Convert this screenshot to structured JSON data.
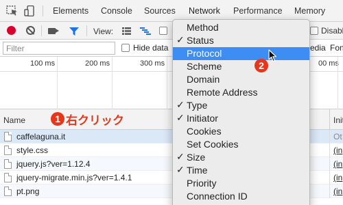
{
  "tabs": {
    "elements": "Elements",
    "console": "Console",
    "sources": "Sources",
    "network": "Network",
    "performance": "Performance",
    "memory": "Memory"
  },
  "toolbar": {
    "view_label": "View:",
    "disable_label": "Disabl"
  },
  "filterbar": {
    "filter_placeholder": "Filter",
    "hide_label": "Hide data",
    "media_label": "edia",
    "font_label": "Fon"
  },
  "timeline": {
    "ticks": [
      "100 ms",
      "200 ms",
      "300 ms",
      "00 ms"
    ]
  },
  "table": {
    "col_name": "Name",
    "col_initiator": "Init",
    "rows": [
      {
        "name": "caffelaguna.it",
        "initiator": "Ot"
      },
      {
        "name": "style.css",
        "initiator": "(in"
      },
      {
        "name": "jquery.js?ver=1.12.4",
        "initiator": "(in"
      },
      {
        "name": "jquery-migrate.min.js?ver=1.4.1",
        "initiator": "(in"
      },
      {
        "name": "pt.png",
        "initiator": "(in"
      }
    ]
  },
  "annotation": {
    "step1_number": "1",
    "step1_text": "右クリック",
    "step2_number": "2"
  },
  "context_menu": {
    "check_glyph": "✓",
    "items": [
      {
        "label": "Method",
        "checked": false
      },
      {
        "label": "Status",
        "checked": true
      },
      {
        "label": "Protocol",
        "checked": false,
        "highlighted": true
      },
      {
        "label": "Scheme",
        "checked": false
      },
      {
        "label": "Domain",
        "checked": false
      },
      {
        "label": "Remote Address",
        "checked": false
      },
      {
        "label": "Type",
        "checked": true
      },
      {
        "label": "Initiator",
        "checked": true
      },
      {
        "label": "Cookies",
        "checked": false
      },
      {
        "label": "Set Cookies",
        "checked": false
      },
      {
        "label": "Size",
        "checked": true
      },
      {
        "label": "Time",
        "checked": true
      },
      {
        "label": "Priority",
        "checked": false
      },
      {
        "label": "Connection ID",
        "checked": false
      }
    ]
  },
  "colors": {
    "record": "#d9002b",
    "active_blue": "#1a73e8",
    "menu_highlight": "#3d8df2",
    "annotation_red": "#e8361a"
  }
}
